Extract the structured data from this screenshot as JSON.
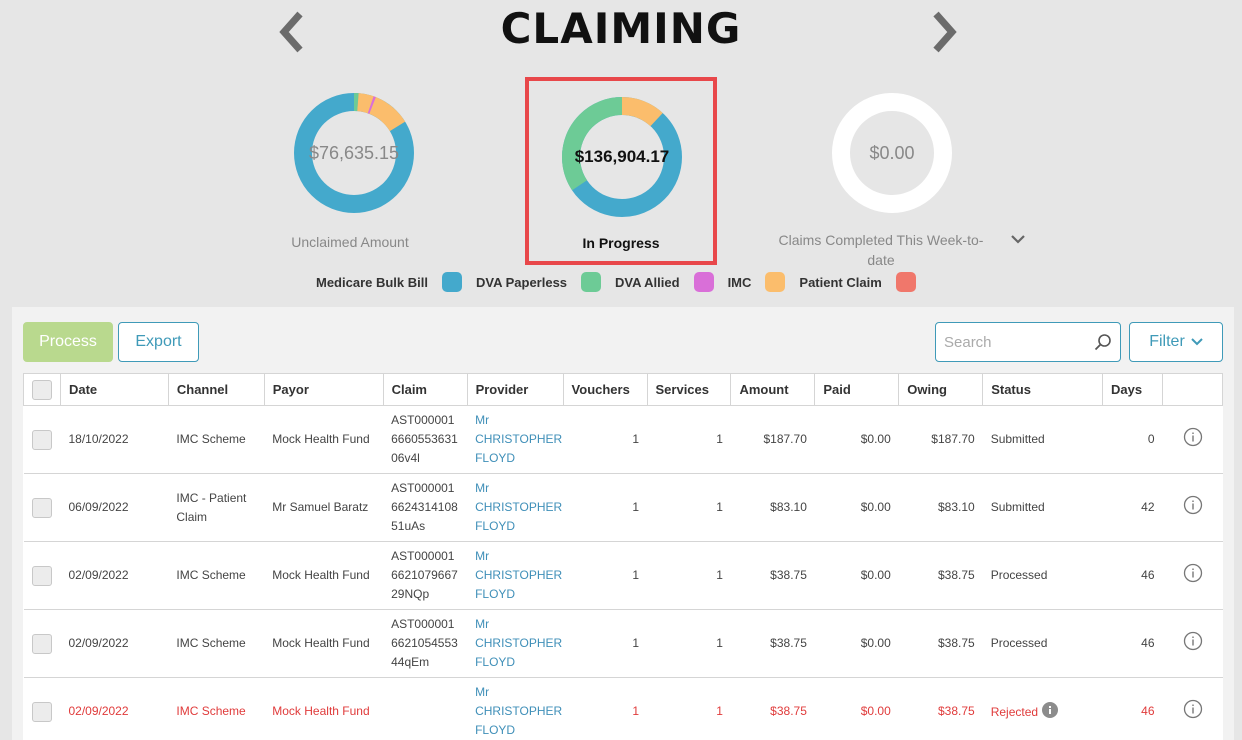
{
  "header": {
    "title": "CLAIMING"
  },
  "summaries": {
    "unclaimed": {
      "value": "$76,635.15",
      "label": "Unclaimed Amount"
    },
    "in_progress": {
      "value": "$136,904.17",
      "label": "In Progress"
    },
    "completed": {
      "value": "$0.00",
      "label": "Claims Completed This Week-to-date"
    }
  },
  "legend": [
    {
      "label": "Medicare Bulk Bill",
      "color": "#44a9cc"
    },
    {
      "label": "DVA Paperless",
      "color": "#6dcb96"
    },
    {
      "label": "DVA Allied",
      "color": "#d96fd8"
    },
    {
      "label": "IMC",
      "color": "#fbbd6c"
    },
    {
      "label": "Patient Claim",
      "color": "#f0776b"
    }
  ],
  "toolbar": {
    "process": "Process",
    "export": "Export",
    "search_placeholder": "Search",
    "filter": "Filter"
  },
  "columns": [
    "Date",
    "Channel",
    "Payor",
    "Claim",
    "Provider",
    "Vouchers",
    "Services",
    "Amount",
    "Paid",
    "Owing",
    "Status",
    "Days"
  ],
  "rows": [
    {
      "date": "18/10/2022",
      "channel": "IMC Scheme",
      "payor": "Mock Health Fund",
      "claim": "AST000001666055363106v4l",
      "provider": "Mr CHRISTOPHER FLOYD",
      "vouchers": "1",
      "services": "1",
      "amount": "$187.70",
      "paid": "$0.00",
      "owing": "$187.70",
      "status": "Submitted",
      "days": "0"
    },
    {
      "date": "06/09/2022",
      "channel": "IMC - Patient Claim",
      "payor": "Mr Samuel Baratz",
      "claim": "AST000001662431410851uAs",
      "provider": "Mr CHRISTOPHER FLOYD",
      "vouchers": "1",
      "services": "1",
      "amount": "$83.10",
      "paid": "$0.00",
      "owing": "$83.10",
      "status": "Submitted",
      "days": "42"
    },
    {
      "date": "02/09/2022",
      "channel": "IMC Scheme",
      "payor": "Mock Health Fund",
      "claim": "AST000001662107966729NQp",
      "provider": "Mr CHRISTOPHER FLOYD",
      "vouchers": "1",
      "services": "1",
      "amount": "$38.75",
      "paid": "$0.00",
      "owing": "$38.75",
      "status": "Processed",
      "days": "46"
    },
    {
      "date": "02/09/2022",
      "channel": "IMC Scheme",
      "payor": "Mock Health Fund",
      "claim": "AST000001662105455344qEm",
      "provider": "Mr CHRISTOPHER FLOYD",
      "vouchers": "1",
      "services": "1",
      "amount": "$38.75",
      "paid": "$0.00",
      "owing": "$38.75",
      "status": "Processed",
      "days": "46"
    },
    {
      "date": "02/09/2022",
      "channel": "IMC Scheme",
      "payor": "Mock Health Fund",
      "claim": "",
      "provider": "Mr CHRISTOPHER FLOYD",
      "vouchers": "1",
      "services": "1",
      "amount": "$38.75",
      "paid": "$0.00",
      "owing": "$38.75",
      "status": "Rejected",
      "days": "46"
    }
  ]
}
